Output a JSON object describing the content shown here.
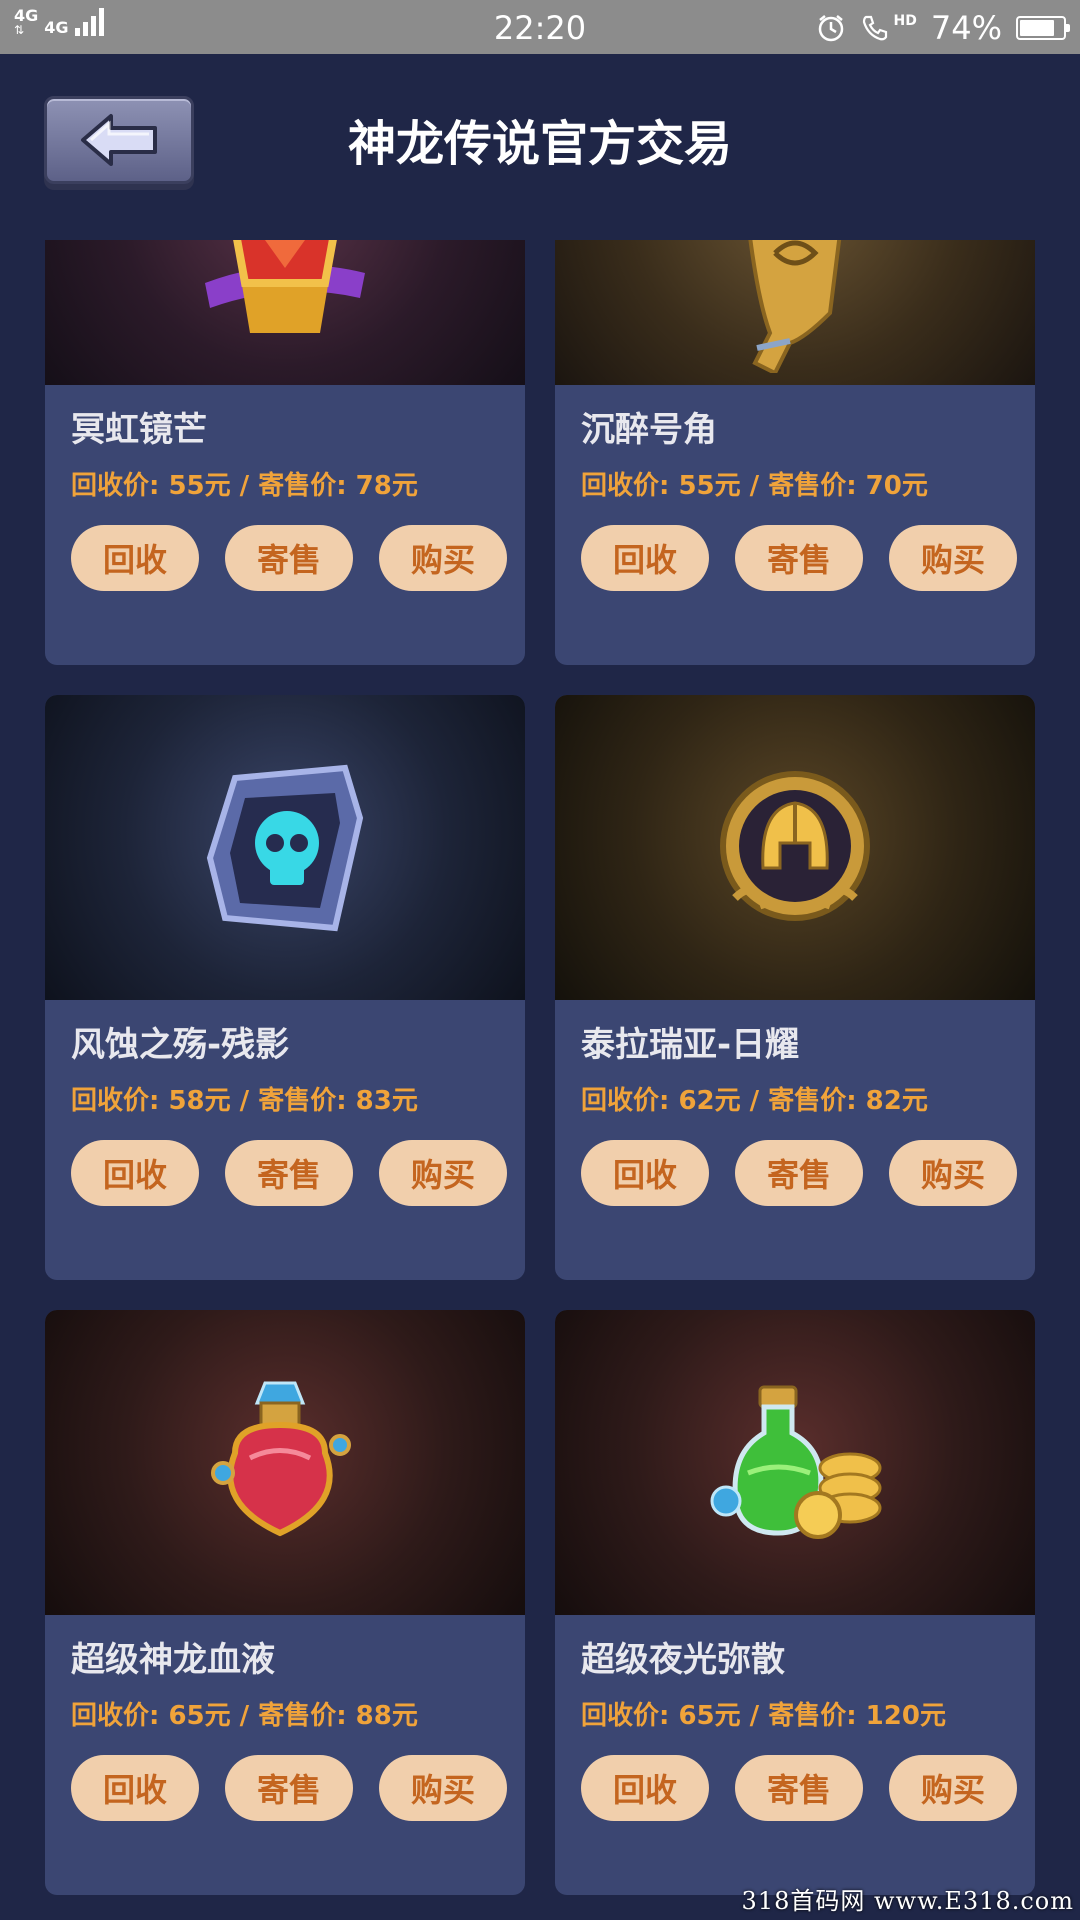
{
  "status_bar": {
    "network": "4G",
    "network2": "4G",
    "time": "22:20",
    "hd": "HD",
    "battery_percent": "74%",
    "battery_level": 0.74
  },
  "header": {
    "title": "神龙传说官方交易",
    "back_icon": "arrow-left-icon"
  },
  "items": [
    {
      "name": "冥虹镜芒",
      "price_text": "回收价: 55元 / 寄售价: 78元",
      "recycle_price": 55,
      "consign_price": 78,
      "icon": "gem-crown-icon"
    },
    {
      "name": "沉醉号角",
      "price_text": "回收价: 55元 / 寄售价: 70元",
      "recycle_price": 55,
      "consign_price": 70,
      "icon": "golden-horn-icon"
    },
    {
      "name": "风蚀之殇-残影",
      "price_text": "回收价: 58元 / 寄售价: 83元",
      "recycle_price": 58,
      "consign_price": 83,
      "icon": "skull-badge-icon"
    },
    {
      "name": "泰拉瑞亚-日耀",
      "price_text": "回收价: 62元 / 寄售价: 82元",
      "recycle_price": 62,
      "consign_price": 82,
      "icon": "golden-helmet-icon"
    },
    {
      "name": "超级神龙血液",
      "price_text": "回收价: 65元 / 寄售价: 88元",
      "recycle_price": 65,
      "consign_price": 88,
      "icon": "red-potion-icon"
    },
    {
      "name": "超级夜光弥散",
      "price_text": "回收价: 65元 / 寄售价: 120元",
      "recycle_price": 65,
      "consign_price": 120,
      "icon": "green-potion-coins-icon"
    }
  ],
  "buttons": {
    "recycle": "回收",
    "consign": "寄售",
    "buy": "购买"
  },
  "colors": {
    "background": "#1f2647",
    "card": "#3b4672",
    "price": "#f0a33a",
    "button_bg": "#f1cfac",
    "button_text": "#c4651f"
  },
  "watermark": "318首码网 www.E318.com"
}
